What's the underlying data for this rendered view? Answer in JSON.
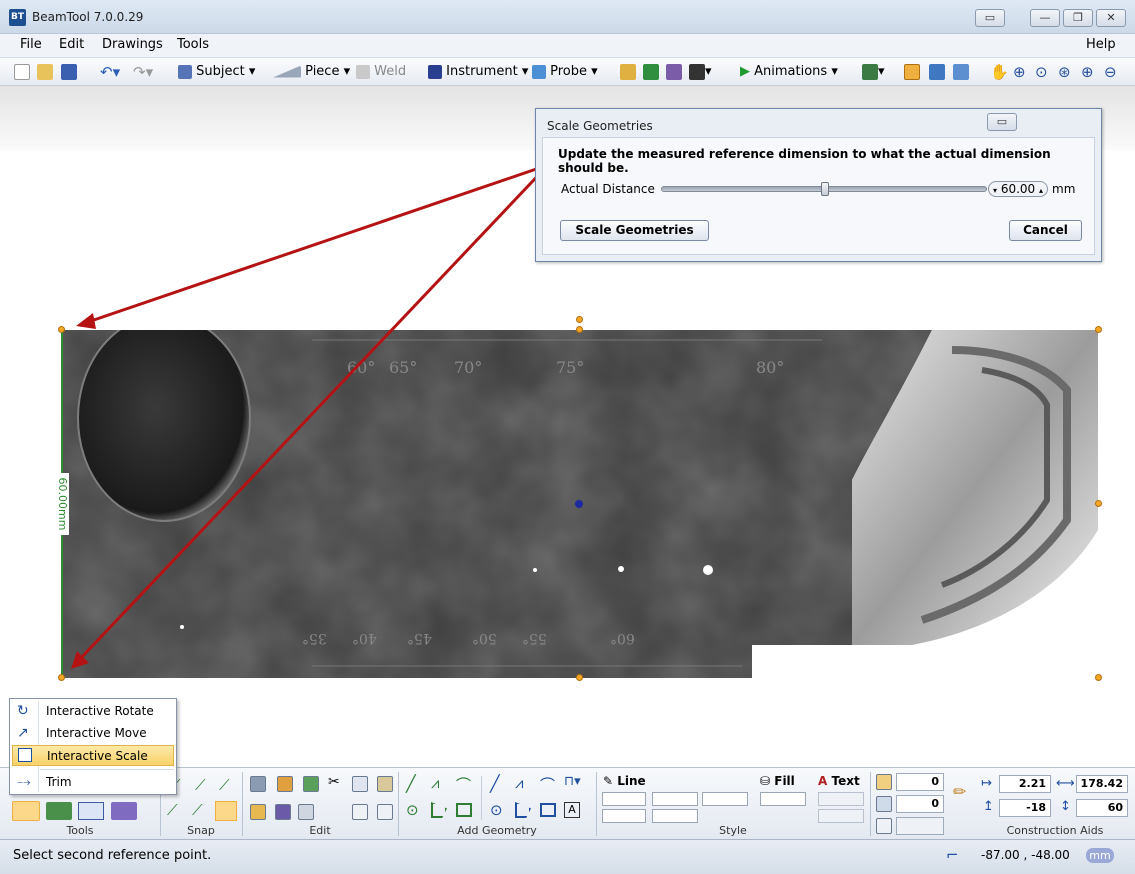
{
  "window": {
    "app_icon_text": "BT",
    "title": "BeamTool 7.0.0.29",
    "minimize": "—",
    "restore": "❐",
    "close": "✕",
    "extra": "▭"
  },
  "menu": {
    "file": "File",
    "edit": "Edit",
    "drawings": "Drawings",
    "tools": "Tools",
    "help": "Help"
  },
  "toolbar": {
    "subject": "Subject",
    "piece": "Piece",
    "weld": "Weld",
    "instrument": "Instrument",
    "probe": "Probe",
    "animations": "Animations",
    "dropdown_arrow": "▾"
  },
  "dialog": {
    "title": "Scale Geometries",
    "instruction": "Update the measured reference dimension to what the actual dimension should be.",
    "distance_label": "Actual Distance",
    "distance_value": "60.00",
    "slider_fraction": 0.5,
    "unit": "mm",
    "scale_button": "Scale Geometries",
    "cancel_button": "Cancel"
  },
  "canvas": {
    "dimension_label": "60.00mm",
    "scale_top": [
      "60°",
      "65°",
      "70°",
      "75°",
      "80°"
    ],
    "scale_bottom": [
      "35°",
      "40°",
      "45°",
      "50°",
      "55°",
      "60°"
    ]
  },
  "context_menu": {
    "items": [
      "Interactive Rotate",
      "Interactive Move",
      "Interactive Scale",
      "Trim"
    ],
    "selected": "Interactive Scale"
  },
  "ribbon": {
    "groups": {
      "tools": "Tools",
      "snap": "Snap",
      "edit": "Edit",
      "add_geometry": "Add Geometry",
      "style": "Style",
      "construction_aids": "Construction Aids"
    },
    "line_label": "Line",
    "fill_label": "Fill",
    "text_label": "Text",
    "field_a": "0",
    "field_b": "0",
    "x_value": "2.21",
    "width_value": "178.42",
    "y_value": "-18",
    "height_value": "60"
  },
  "status": {
    "message": "Select second reference point.",
    "coords": "-87.00 , -48.00",
    "units": "mm"
  },
  "colors": {
    "arrow": "#b51313",
    "dimension": "#2e8b2e",
    "handle": "#f5a623"
  }
}
